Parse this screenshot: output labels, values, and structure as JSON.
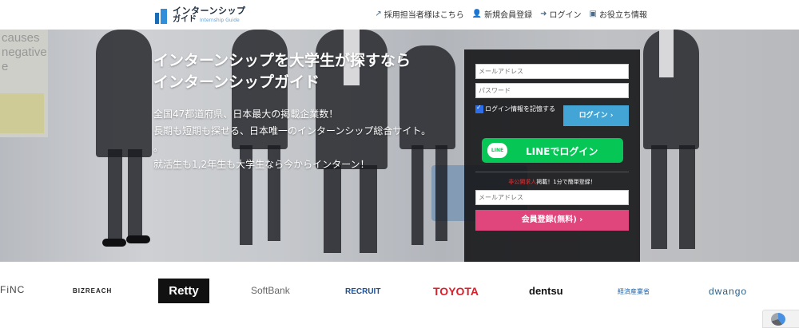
{
  "header": {
    "logo_main": "インターンシップ",
    "logo_sub": "ガイド",
    "logo_tag": "Internship Guide",
    "nav": [
      {
        "icon": "external-link-icon",
        "label": "採用担当者様はこちら"
      },
      {
        "icon": "user-plus-icon",
        "label": "新規会員登録"
      },
      {
        "icon": "sign-in-icon",
        "label": "ログイン"
      },
      {
        "icon": "book-icon",
        "label": "お役立ち情報"
      }
    ]
  },
  "hero": {
    "bg_words": "causes\nnegative\ne",
    "title_line1": "インターンシップを大学生が探すなら",
    "title_line2": "インターンシップガイド",
    "desc_line1": "全国47都道府県、日本最大の掲載企業数！",
    "desc_line2": "長期も短期も探せる、日本唯一のインターンシップ総合サイト。",
    "desc_line3": "就活生も1,2年生も大学生なら今からインターン！"
  },
  "login": {
    "email_placeholder": "メールアドレス",
    "password_placeholder": "パスワード",
    "remember_label": "ログイン情報を記憶する",
    "remember_checked": true,
    "login_button": "ログイン ›",
    "line_badge": "LINE",
    "line_button": "LINEでログイン",
    "promo_red": "非公開求人",
    "promo_rest": "掲載！1分で簡単登録！",
    "register_email_placeholder": "メールアドレス",
    "register_button": "会員登録(無料) ›"
  },
  "logos": [
    "FiNC",
    "BIZREACH",
    "Retty",
    "SoftBank",
    "RECRUIT",
    "TOYOTA",
    "dentsu",
    "経済産業省",
    "dwango"
  ],
  "colors": {
    "accent_blue": "#42a5d5",
    "line_green": "#06c755",
    "register_pink": "#e0457b",
    "toyota_red": "#d9212c"
  }
}
